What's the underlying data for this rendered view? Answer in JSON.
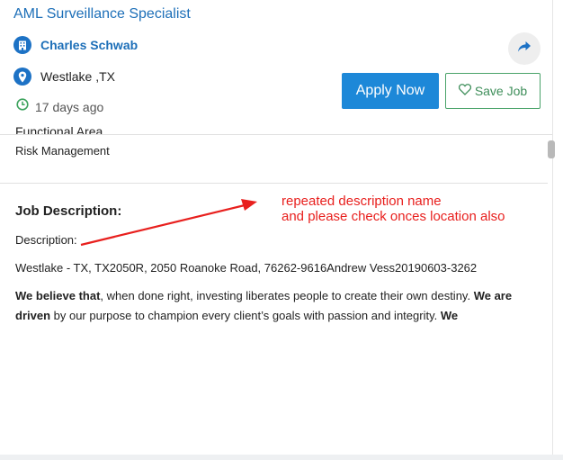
{
  "job": {
    "title": "AML Surveillance Specialist",
    "company": "Charles Schwab",
    "location": "Westlake ,TX",
    "posted": "17 days ago"
  },
  "actions": {
    "apply_label": "Apply Now",
    "save_label": "Save Job"
  },
  "functional_area": {
    "label": "Functional Area",
    "value": "Risk Management"
  },
  "description": {
    "heading": "Job Description:",
    "label": "Description:",
    "location_line": "Westlake - TX, TX2050R, 2050 Roanoke Road, 76262-9616Andrew Vess20190603-3262",
    "p_b1": "We believe that",
    "p_t1": ", when done right, investing liberates people to create their own destiny. ",
    "p_b2": "We are driven",
    "p_t2": " by our purpose to champion every client’s goals with passion and integrity. ",
    "p_b3": "We"
  },
  "annotation": {
    "line1": "repeated description name",
    "line2": "and please check onces location also",
    "color": "#e8201e"
  },
  "colors": {
    "link_blue": "#1d6fb8",
    "apply_blue": "#1d88d8",
    "save_green": "#3e8e5a"
  }
}
